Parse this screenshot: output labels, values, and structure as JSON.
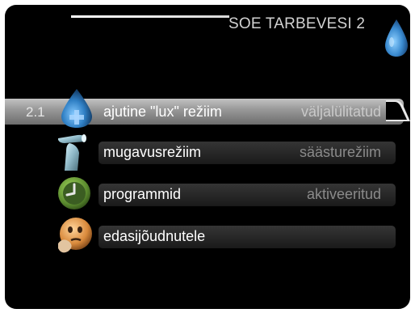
{
  "header": {
    "title": "SOE TARBEVESI 2",
    "icon": "water-drop-icon"
  },
  "menu": {
    "items": [
      {
        "number": "2.1",
        "label": "ajutine \"lux\" režiim",
        "value": "väljalülitatud",
        "icon": "water-drop-plus-icon",
        "selected": true
      },
      {
        "number": "",
        "label": "mugavusrežiim",
        "value": "säästurežiim",
        "icon": "faucet-icon",
        "selected": false
      },
      {
        "number": "",
        "label": "programmid",
        "value": "aktiveeritud",
        "icon": "clock-icon",
        "selected": false
      },
      {
        "number": "",
        "label": "edasijõudnutele",
        "value": "",
        "icon": "thinking-face-icon",
        "selected": false
      }
    ]
  },
  "colors": {
    "background": "#000000",
    "text": "#ffffff",
    "value_text": "#8a8a8a",
    "selected_bar": "#9a9a9a",
    "drop_blue": "#3b8bd0",
    "clock_green": "#5a8a2e"
  }
}
